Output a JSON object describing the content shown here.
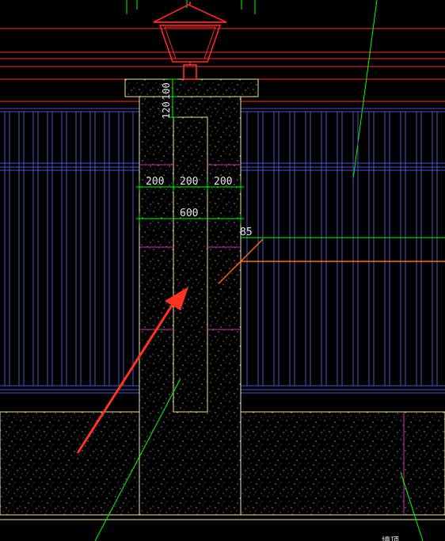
{
  "drawing": {
    "colors": {
      "background": "#000000",
      "railing": "#4a55c8",
      "pillar_outline": "#f0e68c",
      "dimension": "#00ff00",
      "red_lines": "#ff2a2a",
      "leader_orange": "#ff6a1a",
      "arrow": "#ff3322",
      "lamp": "#ff2a2a",
      "joint": "#cc33aa"
    },
    "dimensions": {
      "cap_top": "100",
      "cap_second": "120",
      "col_left": "200",
      "col_center": "200",
      "col_right": "200",
      "total_width": "600",
      "joint_depth": "85"
    },
    "corner_text": "墙顶…"
  }
}
